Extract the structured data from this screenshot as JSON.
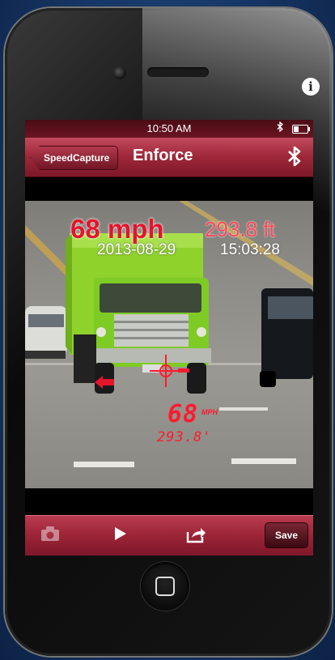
{
  "status_bar": {
    "time": "10:50 AM",
    "bluetooth_icon": "bluetooth-icon",
    "battery_icon": "battery-icon"
  },
  "nav": {
    "back_label": "SpeedCapture",
    "title": "Enforce",
    "action_icon": "bluetooth-icon"
  },
  "capture": {
    "overlay_speed": "68 mph",
    "overlay_distance": "293.8 ft",
    "overlay_date": "2013-08-29",
    "overlay_time": "15:03:28",
    "lcd_speed": "68",
    "lcd_unit": "MPH",
    "lcd_distance": "293.8'"
  },
  "toolbar": {
    "camera_icon": "camera-icon",
    "play_icon": "play-icon",
    "share_icon": "share-icon",
    "save_label": "Save"
  },
  "device": {
    "info_symbol": "i"
  },
  "colors": {
    "accent": "#9d2738",
    "overlay_red": "#e3152b",
    "lcd_red": "#ff1a2e"
  }
}
